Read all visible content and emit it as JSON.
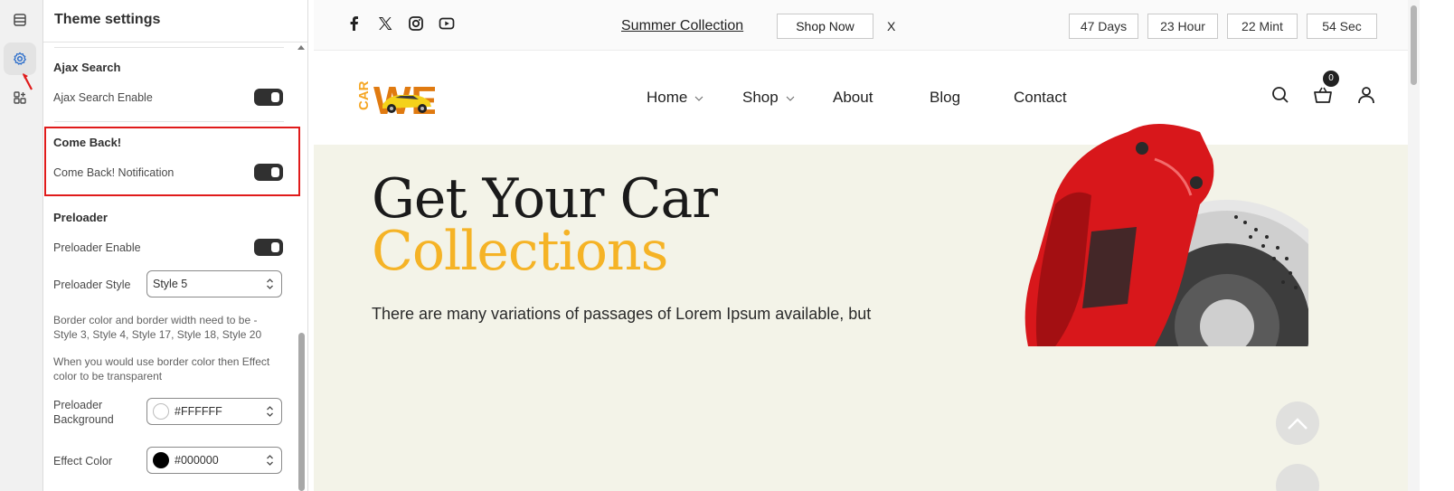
{
  "panel": {
    "title": "Theme settings",
    "sections": {
      "ajax": {
        "title": "Ajax Search",
        "row_label": "Ajax Search Enable",
        "enabled": true
      },
      "comeback": {
        "title": "Come Back!",
        "row_label": "Come Back! Notification",
        "enabled": true
      },
      "preloader": {
        "title": "Preloader",
        "enable_label": "Preloader Enable",
        "enabled": true,
        "style_label": "Preloader Style",
        "style_value": "Style 5",
        "help1": "Border color and border width need to be - Style 3, Style 4, Style 17, Style 18, Style 20",
        "help2": "When you would use border color then Effect color to be transparent",
        "bg_label": "Preloader Background",
        "bg_value": "#FFFFFF",
        "effect_label": "Effect Color",
        "effect_value": "#000000"
      }
    }
  },
  "preview": {
    "topbar": {
      "social": [
        "facebook-icon",
        "x-icon",
        "instagram-icon",
        "youtube-icon"
      ],
      "promo_link": "Summer Collection",
      "shop_now": "Shop Now",
      "close": "X",
      "timer": [
        "47 Days",
        "23 Hour",
        "22 Mint",
        "54 Sec"
      ]
    },
    "logo": {
      "word1": "CAR",
      "word2": "WE"
    },
    "nav": {
      "home": "Home",
      "shop": "Shop",
      "about": "About",
      "blog": "Blog",
      "contact": "Contact"
    },
    "cart_count": "0",
    "hero": {
      "title_line1": "Get Your Car",
      "title_line2": "Collections",
      "text": "There are many variations of passages of Lorem Ipsum available, but"
    }
  },
  "colors": {
    "accent": "#f5b326",
    "highlight_border": "#e01b1b",
    "rail_active": "#2c6ecb",
    "toggle_on": "#303030"
  }
}
